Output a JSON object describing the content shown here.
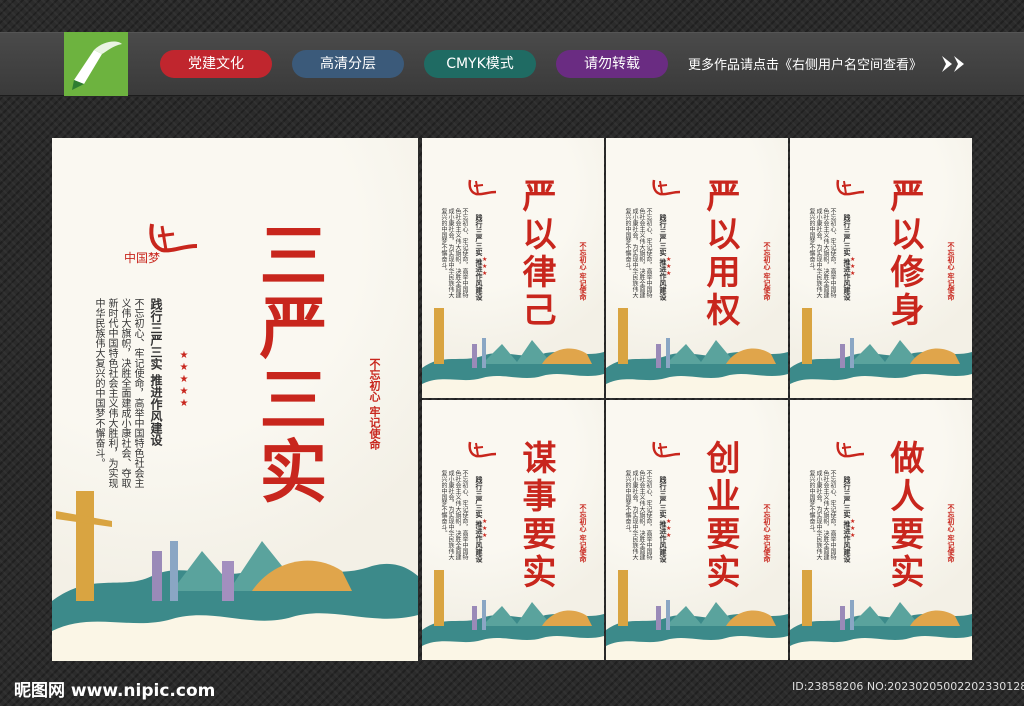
{
  "header": {
    "tags": [
      {
        "label": "党建文化",
        "color": "#c0262e"
      },
      {
        "label": "高清分层",
        "color": "#3b5a7a"
      },
      {
        "label": "CMYK模式",
        "color": "#1f6b63"
      },
      {
        "label": "请勿转载",
        "color": "#6a2c82"
      }
    ],
    "tagline": "更多作品请点击《右侧用户名空间查看》",
    "arrow_icon": "double-chevron-right-icon"
  },
  "main_poster": {
    "title": "三严三实",
    "subtitle": "践行三严三实 推进作风建设",
    "body": "不忘初心、牢记使命，高举中国特色社会主义伟大旗帜，决胜全面建成小康社会、夺取新时代中国特色社会主义伟大胜利，为实现中华民族伟大复兴的中国梦不懈奋斗。",
    "seal": "不忘初心 牢记使命",
    "logo_text": "中国梦"
  },
  "panels": [
    {
      "title": "严以律己",
      "subtitle": "践行三严三实 推进作风建设",
      "seal": "不忘初心 牢记使命"
    },
    {
      "title": "严以用权",
      "subtitle": "践行三严三实 推进作风建设",
      "seal": "不忘初心 牢记使命"
    },
    {
      "title": "严以修身",
      "subtitle": "践行三严三实 推进作风建设",
      "seal": "不忘初心 牢记使命"
    },
    {
      "title": "谋事要实",
      "subtitle": "践行三严三实 推进作风建设",
      "seal": "不忘初心 牢记使命"
    },
    {
      "title": "创业要实",
      "subtitle": "践行三严三实 推进作风建设",
      "seal": "不忘初心 牢记使命"
    },
    {
      "title": "做人要实",
      "subtitle": "践行三严三实 推进作风建设",
      "seal": "不忘初心 牢记使命"
    }
  ],
  "panel_body": "不忘初心、牢记使命，高举中国特色社会主义伟大旗帜，决胜全面建成小康社会，为实现中华民族伟大复兴的中国梦不懈奋斗。",
  "footer": {
    "watermark": "昵图网 www.nipic.com",
    "id": "ID:23858206 NO:20230205002202330128"
  },
  "colors": {
    "accent_red": "#c8261d",
    "poster_bg": "#f3f0e6",
    "gold": "#d9a441"
  }
}
